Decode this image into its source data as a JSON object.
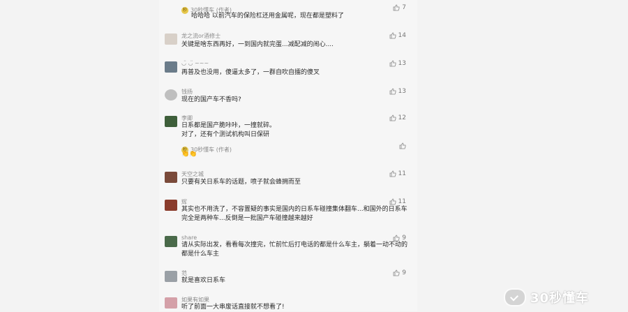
{
  "comments": [
    {
      "author": "",
      "text_lines": [
        "哈哈哈 以前汽车的保险杠还用金属呢，现在都是塑料了"
      ],
      "likes": "7",
      "reply_author": "30秒懂车 (作者)",
      "is_reply_only": true
    },
    {
      "author": "龙之流or酒修士",
      "text_lines": [
        "关键是啥东西再好，一到国内就完蛋...减配减的闹心...."
      ],
      "likes": "14",
      "avatar_color": "#d8d0c8"
    },
    {
      "author": "◡̈ ◡̈ ~~~",
      "text_lines": [
        "再普及也没用，傻逼太多了，一群自吹自擂的傻叉"
      ],
      "likes": "13",
      "avatar_color": "#6b7c8a"
    },
    {
      "author": "钱扬",
      "text_lines": [
        "现在的国产车不香吗?"
      ],
      "likes": "13",
      "avatar_color": "#bfbfbf"
    },
    {
      "author": "李卿",
      "text_lines": [
        "日系都是国产脆咔咔，一撞就碎。",
        "对了，还有个测试机构叫日保研"
      ],
      "likes": "12",
      "avatar_color": "#3e5f3a",
      "reply_author": "30秒懂车 (作者)",
      "reply_emoji": "👏👏"
    },
    {
      "author": "天空之城",
      "text_lines": [
        "只要有关日系车的话题，喷子就会蜂拥而至"
      ],
      "likes": "11",
      "avatar_color": "#7a4a3a"
    },
    {
      "author": "辉",
      "text_lines": [
        "其实也不用洗了，不容置疑的事实是国内的日系车碰撞集体翻车...和国外的日系车",
        "完全是两种车...反倒是一批国产车碰撞越来越好"
      ],
      "likes": "11",
      "avatar_color": "#8a3c2c"
    },
    {
      "author": "share",
      "text_lines": [
        "请从实际出发，看看每次撞完，忙前忙后打电话的都是什么车主，躺着一动不动的",
        "都是什么车主"
      ],
      "likes": "9",
      "avatar_color": "#4a6a4a"
    },
    {
      "author": "范",
      "text_lines": [
        "就是喜欢日系车"
      ],
      "likes": "9",
      "avatar_color": "#9aa0a6"
    },
    {
      "author": "如果有如果",
      "text_lines": [
        "听了前面一大串废话直接就不想看了!"
      ],
      "likes": "",
      "avatar_color": "#d4a0a8"
    }
  ],
  "watermark": {
    "text": "30秒懂车",
    "icon": "wechat-check-logo"
  }
}
